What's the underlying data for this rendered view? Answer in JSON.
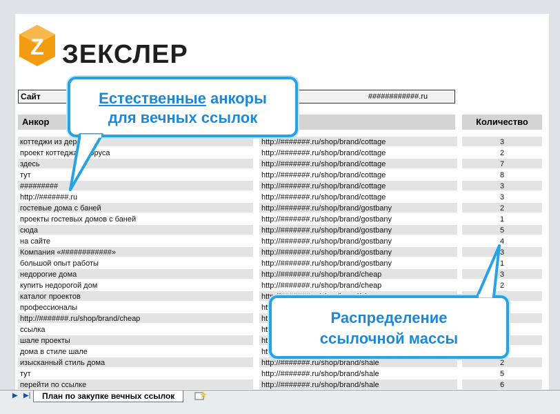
{
  "brand": {
    "name": "ЗЕКСЛЕР",
    "logo_letter": "Z",
    "logo_color": "#f39c12"
  },
  "site": {
    "label": "Сайт",
    "value": "############.ru"
  },
  "columns": {
    "anchor": "Анкор",
    "url": "",
    "count": "Количество"
  },
  "rows": [
    {
      "anchor": "коттеджи из дерева",
      "url": "http://#######.ru/shop/brand/cottage",
      "count": "3"
    },
    {
      "anchor": "проект коттеджа из бруса",
      "url": "http://#######.ru/shop/brand/cottage",
      "count": "2"
    },
    {
      "anchor": "здесь",
      "url": "http://#######.ru/shop/brand/cottage",
      "count": "7"
    },
    {
      "anchor": "тут",
      "url": "http://#######.ru/shop/brand/cottage",
      "count": "8"
    },
    {
      "anchor": "#########",
      "url": "http://#######.ru/shop/brand/cottage",
      "count": "3"
    },
    {
      "anchor": "http://#######.ru",
      "url": "http://#######.ru/shop/brand/cottage",
      "count": "3"
    },
    {
      "anchor": "гостевые дома с баней",
      "url": "http://#######.ru/shop/brand/gostbany",
      "count": "2"
    },
    {
      "anchor": "проекты гостевых домов с баней",
      "url": "http://#######.ru/shop/brand/gostbany",
      "count": "1"
    },
    {
      "anchor": "сюда",
      "url": "http://#######.ru/shop/brand/gostbany",
      "count": "5"
    },
    {
      "anchor": "на сайте",
      "url": "http://#######.ru/shop/brand/gostbany",
      "count": "4"
    },
    {
      "anchor": "Компания «############»",
      "url": "http://#######.ru/shop/brand/gostbany",
      "count": "3"
    },
    {
      "anchor": "большой опыт работы",
      "url": "http://#######.ru/shop/brand/gostbany",
      "count": "1"
    },
    {
      "anchor": "недорогие дома",
      "url": "http://#######.ru/shop/brand/cheap",
      "count": "3"
    },
    {
      "anchor": "купить недорогой дом",
      "url": "http://#######.ru/shop/brand/cheap",
      "count": "2"
    },
    {
      "anchor": "каталог проектов",
      "url": "http://#######.ru/shop/brand/cheap",
      "count": ""
    },
    {
      "anchor": "профессионалы",
      "url": "http://#######.ru/shop/brand/cheap",
      "count": ""
    },
    {
      "anchor": "http://#######.ru/shop/brand/cheap",
      "url": "http://#######.ru/shop/brand/cheap",
      "count": ""
    },
    {
      "anchor": "ссылка",
      "url": "http://#######.ru/shop/brand/shale",
      "count": ""
    },
    {
      "anchor": "шале проекты",
      "url": "http://#######.ru/shop/brand/shale",
      "count": ""
    },
    {
      "anchor": "дома в стиле шале",
      "url": "http://#######.ru/shop/brand/shale",
      "count": ""
    },
    {
      "anchor": "изысканный стиль дома",
      "url": "http://#######.ru/shop/brand/shale",
      "count": "2"
    },
    {
      "anchor": "тут",
      "url": "http://#######.ru/shop/brand/shale",
      "count": "5"
    },
    {
      "anchor": "перейти по ссылке",
      "url": "http://#######.ru/shop/brand/shale",
      "count": "6"
    }
  ],
  "tabs": {
    "sheet_name": "План по закупке вечных ссылок",
    "nav_first": "▶",
    "nav_last": "▶|"
  },
  "callouts": {
    "first": {
      "line1_underlined": "Естественные",
      "line1_rest": " анкоры",
      "line2": "для вечных ссылок"
    },
    "second": {
      "line1": "Распределение",
      "line2": "ссылочной массы"
    }
  },
  "colors": {
    "callout_border": "#27a3e3",
    "callout_text": "#1e88d6",
    "row_shade": "#e3e3e3"
  }
}
